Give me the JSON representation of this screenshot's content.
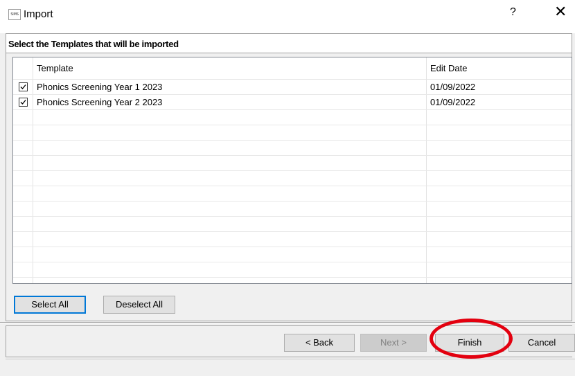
{
  "window": {
    "icon_text": "SIMS",
    "title": "Import",
    "help_label": "?",
    "close_label": "✕"
  },
  "section": {
    "header": "Select the Templates that will be imported"
  },
  "grid": {
    "columns": [
      "Template",
      "Edit Date"
    ],
    "rows": [
      {
        "checked": true,
        "template": "Phonics Screening Year 1 2023",
        "edit_date": "01/09/2022"
      },
      {
        "checked": true,
        "template": "Phonics Screening Year 2 2023",
        "edit_date": "01/09/2022"
      }
    ]
  },
  "buttons": {
    "select_all": "Select All",
    "deselect_all": "Deselect All",
    "back": "< Back",
    "next": "Next >",
    "finish": "Finish",
    "cancel": "Cancel"
  },
  "colors": {
    "highlight": "#e3000f",
    "focus": "#0078d7"
  }
}
